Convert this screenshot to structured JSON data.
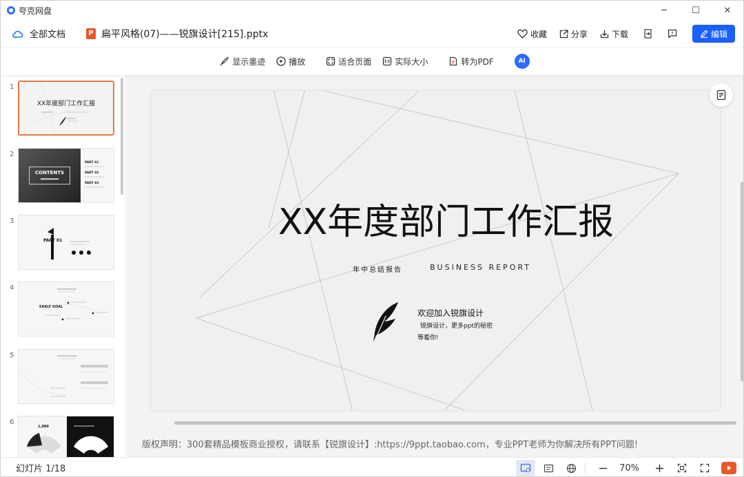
{
  "app": {
    "name": "夸克网盘"
  },
  "window": {
    "minimize": "─",
    "maximize": "☐",
    "close": "✕"
  },
  "topbar": {
    "all_docs": "全部文档",
    "file_badge": "P",
    "filename": "扁平风格(07)——锐旗设计[215].pptx",
    "favorite": "收藏",
    "share": "分享",
    "download": "下载",
    "edit": "编辑"
  },
  "toolbar": {
    "show_ink": "显示墨迹",
    "play": "播放",
    "fit_page": "适合页面",
    "actual_size": "实际大小",
    "to_pdf": "转为PDF",
    "ai": "AI"
  },
  "thumbnails": [
    {
      "num": "1",
      "title": "XX年度部门工作汇报"
    },
    {
      "num": "2",
      "title": "CONTENTS",
      "items": [
        "PART 01",
        "PART 02",
        "PART 03"
      ]
    },
    {
      "num": "3",
      "title": "PART 01"
    },
    {
      "num": "4",
      "title": "EARLY GOAL"
    },
    {
      "num": "5",
      "title": ""
    },
    {
      "num": "6",
      "title": "1,000"
    }
  ],
  "slide": {
    "title": "XX年度部门工作汇报",
    "subtitle_cn": "年中总结报告",
    "subtitle_en": "BUSINESS REPORT",
    "welcome": "欢迎加入锐旗设计",
    "welcome_line1": "锐旗设计，更多ppt的秘密",
    "welcome_line2": "等着你!"
  },
  "copyright": "版权声明：300套精品模板商业授权，请联系【锐旗设计】:https://9ppt.taobao.com，专业PPT老师为你解决所有PPT问题!",
  "status": {
    "slide_count": "幻灯片 1/18",
    "zoom": "70%"
  }
}
